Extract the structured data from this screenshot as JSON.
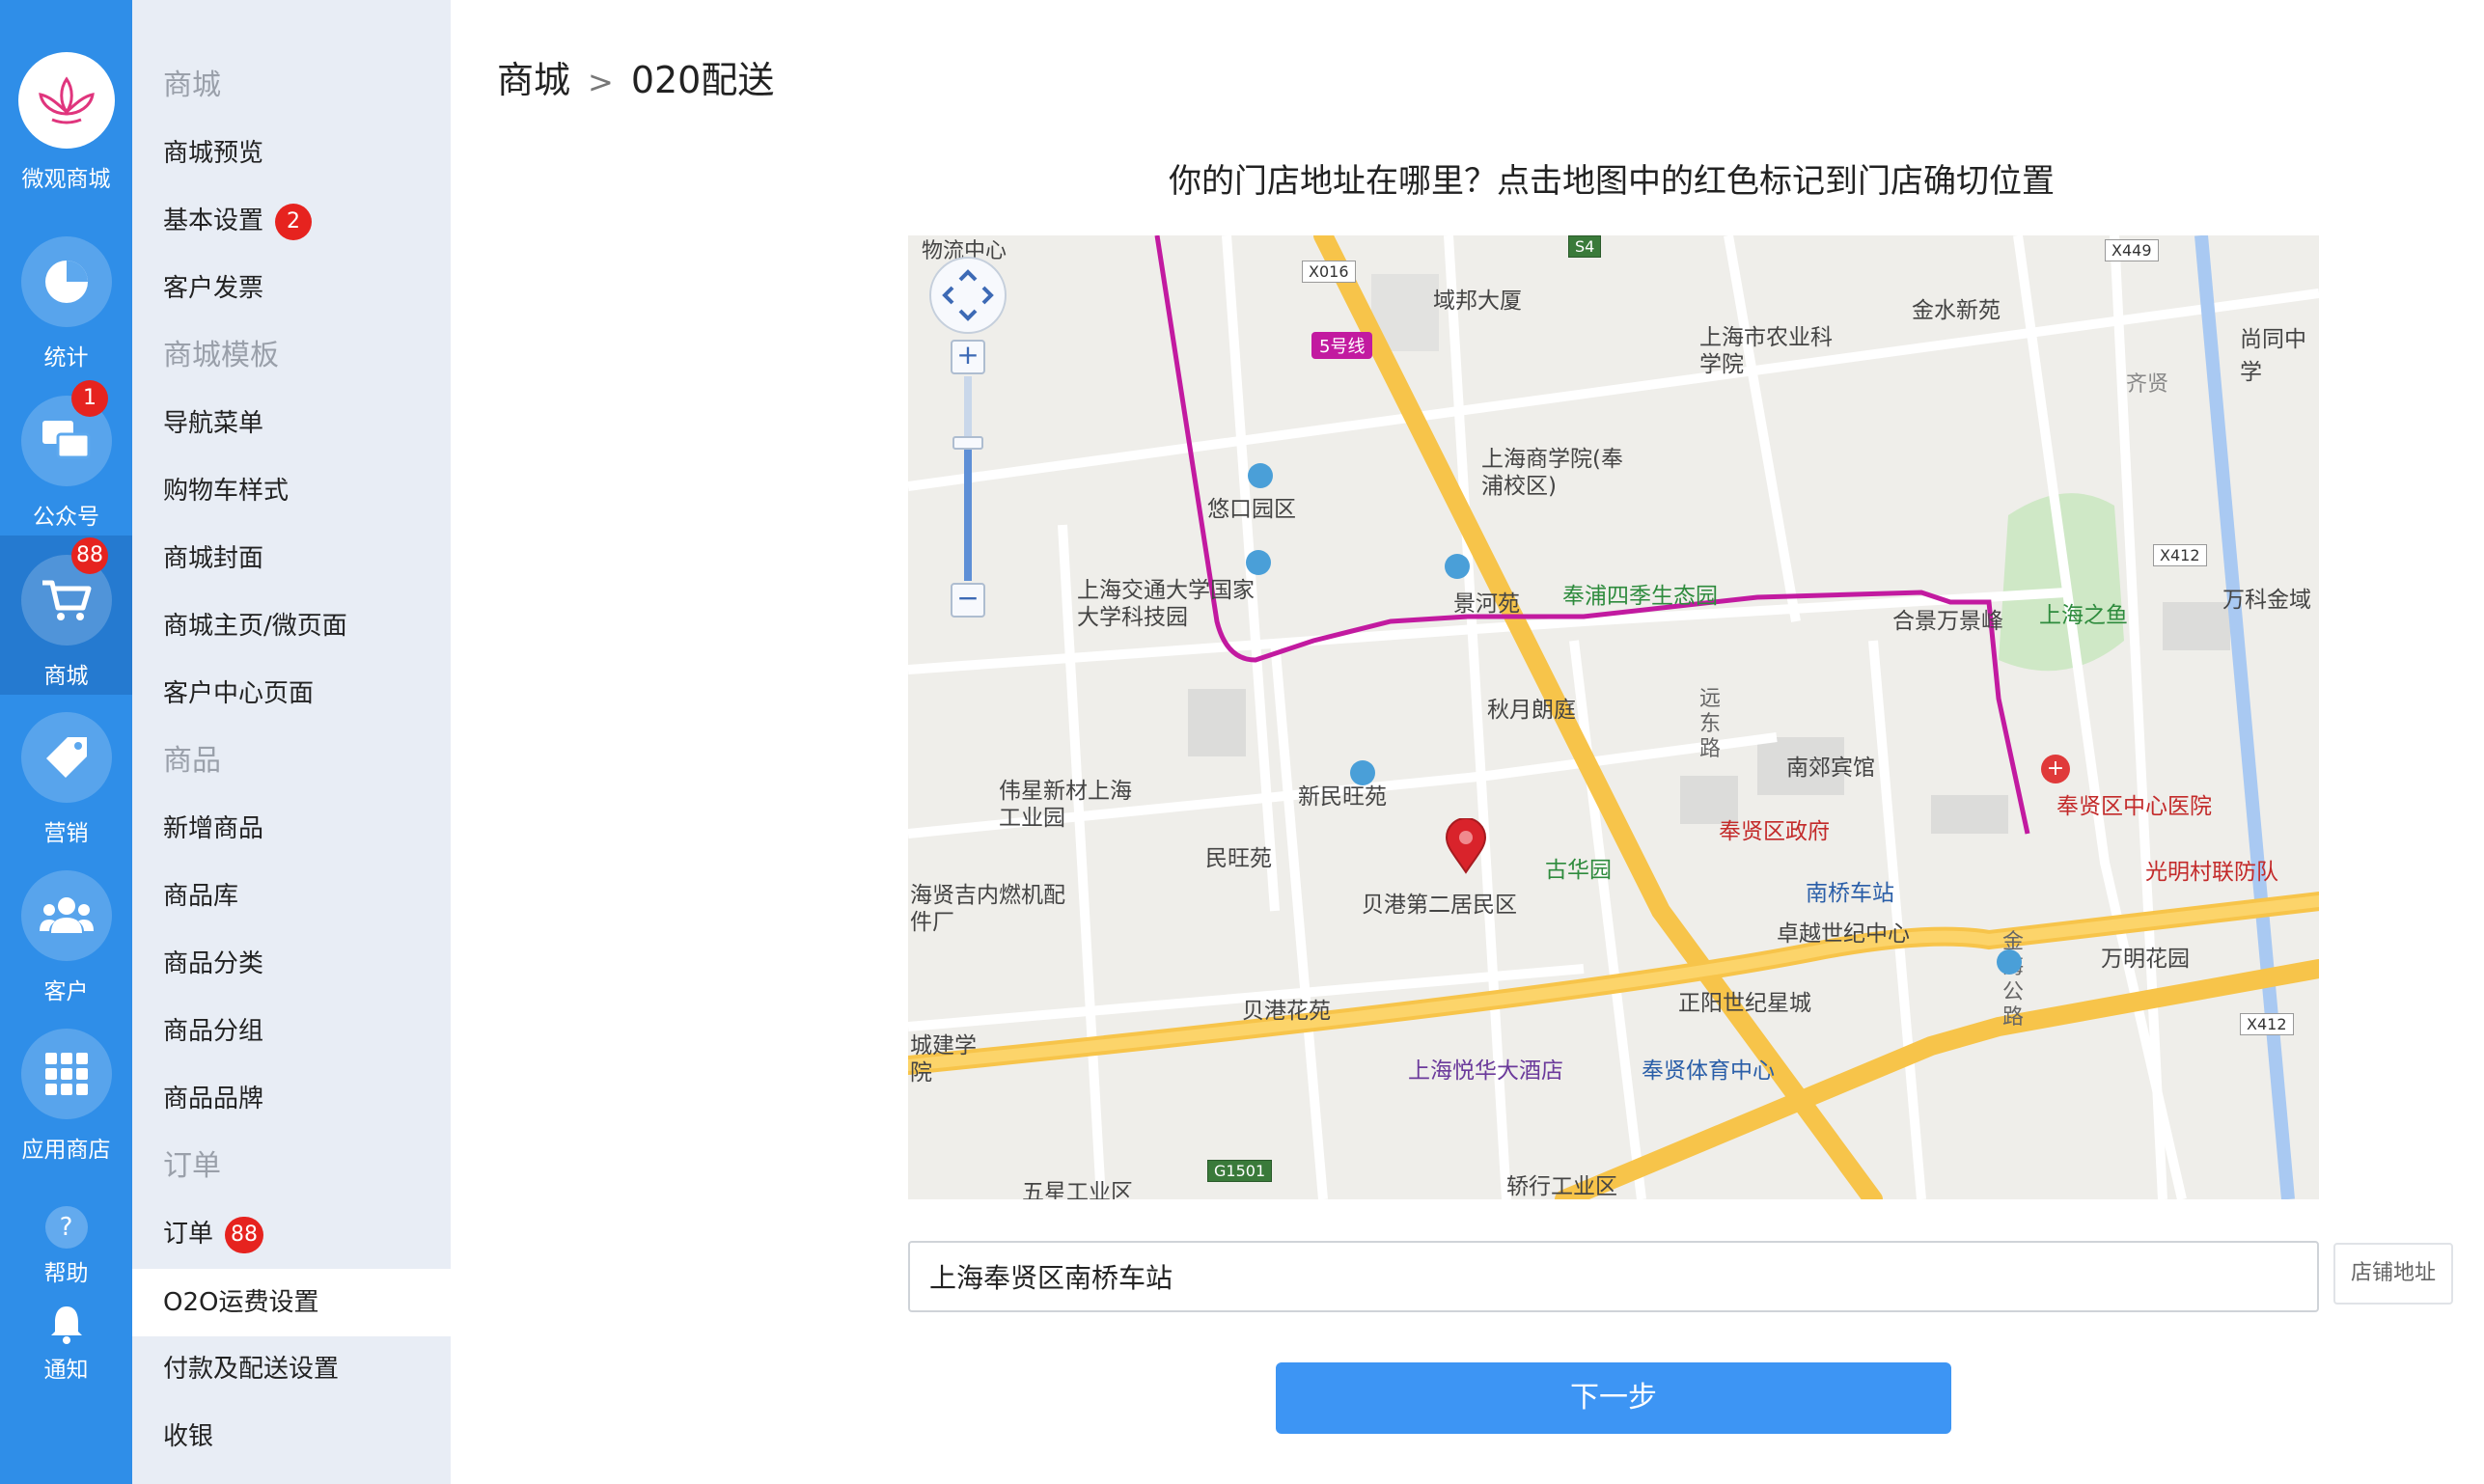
{
  "rail": {
    "logo_label": "微观商城",
    "items": [
      {
        "label": "统计",
        "icon": "pie-chart-icon"
      },
      {
        "label": "公众号",
        "icon": "chat-icon",
        "badge": "1"
      },
      {
        "label": "商城",
        "icon": "cart-icon",
        "badge": "88"
      },
      {
        "label": "营销",
        "icon": "tag-icon"
      },
      {
        "label": "客户",
        "icon": "users-icon"
      },
      {
        "label": "应用商店",
        "icon": "grid-icon"
      }
    ],
    "help_label": "帮助",
    "help_glyph": "?",
    "notify_label": "通知"
  },
  "menu": {
    "sections": [
      {
        "title": "商城",
        "items": [
          "商城预览",
          "基本设置",
          "客户发票"
        ]
      },
      {
        "title": "商城模板",
        "items": [
          "导航菜单",
          "购物车样式",
          "商城封面",
          "商城主页/微页面",
          "客户中心页面"
        ]
      },
      {
        "title": "商品",
        "items": [
          "新增商品",
          "商品库",
          "商品分类",
          "商品分组",
          "商品品牌"
        ]
      },
      {
        "title": "订单",
        "items": [
          "订单",
          "O2O运费设置",
          "付款及配送设置",
          "收银"
        ]
      }
    ],
    "badges": {
      "基本设置": "2",
      "订单": "88"
    },
    "active": "O2O运费设置"
  },
  "breadcrumb": {
    "parent": "商城",
    "separator": ">",
    "current": "020配送"
  },
  "question": "你的门店地址在哪里？点击地图中的红色标记到门店确切位置",
  "map": {
    "zoom_in": "+",
    "zoom_out": "−",
    "labels": [
      "物流中心",
      "域邦大厦",
      "上海市农业科学院",
      "金水新苑",
      "尚同中学",
      "齐贤",
      "悠口园区",
      "上海商学院(奉浦校区)",
      "上海交通大学国家大学科技园",
      "景河苑",
      "奉浦四季生态园",
      "合景万景峰",
      "上海之鱼",
      "万科金域",
      "秋月朗庭",
      "远东路",
      "南郊宾馆",
      "伟星新材上海工业园",
      "新民旺苑",
      "民旺苑",
      "奉贤区政府",
      "奉贤区中心医院",
      "光明村联防队",
      "古华园",
      "南桥车站",
      "海贤吉内燃机配件厂",
      "贝港第二居民区",
      "卓越世纪中心",
      "万明花园",
      "贝港花苑",
      "正阳世纪星城",
      "金海公路",
      "城建学院",
      "上海悦华大酒店",
      "奉贤体育中心",
      "五星工业区",
      "轿行工业区"
    ],
    "road_shields": [
      "X016",
      "S4",
      "X449",
      "X412",
      "X412",
      "G1501"
    ],
    "metro_label": "5号线"
  },
  "address": {
    "value": "上海奉贤区南桥车站",
    "store_button": "店铺地址"
  },
  "next_button": "下一步",
  "colors": {
    "rail": "#2f8ee8",
    "menu_bg": "#e8edf5",
    "accent": "#3d95f4",
    "badge": "#e6231f",
    "metro": "#c21aa0",
    "highway": "#f7c44a"
  }
}
